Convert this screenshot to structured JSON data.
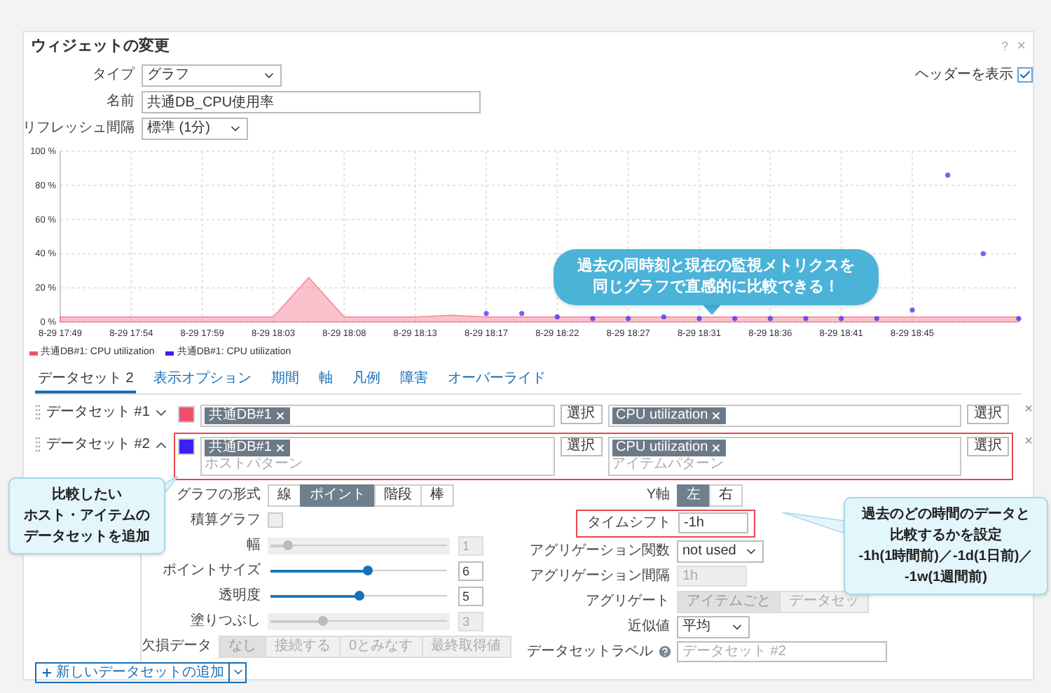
{
  "dialog": {
    "title": "ウィジェットの変更",
    "help": "?",
    "close": "×"
  },
  "form": {
    "type": {
      "label": "タイプ",
      "value": "グラフ"
    },
    "name": {
      "label": "名前",
      "value": "共通DB_CPU使用率"
    },
    "refresh": {
      "label": "リフレッシュ間隔",
      "value": "標準 (1分)"
    },
    "show_header": {
      "label": "ヘッダーを表示",
      "checked": true
    }
  },
  "chart_data": {
    "type": "line",
    "grid": true,
    "ylim": [
      0,
      100
    ],
    "yticks": [
      {
        "value": 0,
        "label": "0 %"
      },
      {
        "value": 20,
        "label": "20 %"
      },
      {
        "value": 40,
        "label": "40 %"
      },
      {
        "value": 60,
        "label": "60 %"
      },
      {
        "value": 80,
        "label": "80 %"
      },
      {
        "value": 100,
        "label": "100 %"
      }
    ],
    "categories": [
      "8-29 17:49",
      null,
      "8-29 17:54",
      null,
      "8-29 17:59",
      null,
      "8-29 18:03",
      null,
      "8-29 18:08",
      null,
      "8-29 18:13",
      null,
      "8-29 18:17",
      null,
      "8-29 18:22",
      null,
      "8-29 18:27",
      null,
      "8-29 18:31",
      null,
      "8-29 18:36",
      null,
      "8-29 18:41",
      null,
      "8-29 18:45",
      null,
      null,
      null
    ],
    "series": [
      {
        "name": "共通DB#1: CPU utilization",
        "color": "#f0506e",
        "type": "area",
        "values": [
          3,
          3,
          3,
          3,
          3,
          3,
          3,
          26,
          3,
          3,
          3,
          4,
          3,
          3,
          3,
          3,
          3,
          3,
          3,
          3,
          3,
          3,
          3,
          3,
          3,
          3,
          3,
          3
        ]
      },
      {
        "name": "共通DB#1: CPU utilization",
        "color": "#3b1ff5",
        "type": "scatter",
        "values": [
          null,
          null,
          null,
          null,
          null,
          null,
          null,
          null,
          null,
          null,
          null,
          null,
          5,
          5,
          3,
          2,
          2,
          3,
          2,
          2,
          2,
          2,
          2,
          2,
          7,
          86,
          40,
          2
        ]
      }
    ]
  },
  "callouts": [
    {
      "kind": "main",
      "lines": [
        "過去の同時刻と現在の監視メトリクスを",
        "同じグラフで直感的に比較できる！"
      ]
    },
    {
      "kind": "note",
      "lines": [
        "比較したい",
        "ホスト・アイテムの",
        "データセットを追加"
      ]
    },
    {
      "kind": "note",
      "lines": [
        "過去のどの時間のデータと",
        "比較するかを設定",
        "-1h(1時間前)／-1d(1日前)／",
        "-1w(1週間前)"
      ]
    }
  ],
  "tabs": [
    {
      "label": "データセット 2",
      "selected": true
    },
    {
      "label": "表示オプション",
      "selected": false
    },
    {
      "label": "期間",
      "selected": false
    },
    {
      "label": "軸",
      "selected": false
    },
    {
      "label": "凡例",
      "selected": false
    },
    {
      "label": "障害",
      "selected": false
    },
    {
      "label": "オーバーライド",
      "selected": false
    }
  ],
  "datasets": [
    {
      "label": "データセット #1",
      "expanded": false,
      "highlighted": false,
      "color": "#f0506e",
      "host_tags": [
        "共通DB#1"
      ],
      "item_tags": [
        "CPU utilization"
      ],
      "select_host": "選択",
      "select_item": "選択",
      "remove": "×"
    },
    {
      "label": "データセット #2",
      "expanded": true,
      "highlighted": true,
      "color": "#3b1ff5",
      "host_tags": [
        "共通DB#1"
      ],
      "host_placeholder": "ホストパターン",
      "item_tags": [
        "CPU utilization"
      ],
      "item_placeholder": "アイテムパターン",
      "select_host": "選択",
      "select_item": "選択",
      "remove": "×"
    }
  ],
  "options_left": {
    "graph_type": {
      "label": "グラフの形式",
      "options": [
        {
          "label": "線",
          "selected": false
        },
        {
          "label": "ポイント",
          "selected": true
        },
        {
          "label": "階段",
          "selected": false
        },
        {
          "label": "棒",
          "selected": false
        }
      ]
    },
    "stacked": {
      "label": "積算グラフ",
      "checked": false,
      "disabled": true
    },
    "sliders": [
      {
        "label": "幅",
        "level": 0.1,
        "value": "1",
        "disabled": true
      },
      {
        "label": "ポイントサイズ",
        "level": 0.55,
        "value": "6",
        "disabled": false
      },
      {
        "label": "透明度",
        "level": 0.5,
        "value": "5",
        "disabled": false
      },
      {
        "label": "塗りつぶし",
        "level": 0.3,
        "value": "3",
        "disabled": true
      }
    ],
    "missing_data": {
      "label": "欠損データ",
      "disabled": true,
      "options": [
        {
          "label": "なし",
          "selected": true
        },
        {
          "label": "接続する",
          "selected": false
        },
        {
          "label": "0とみなす",
          "selected": false
        },
        {
          "label": "最終取得値",
          "selected": false
        }
      ]
    }
  },
  "options_right": {
    "y_axis": {
      "label": "Y軸",
      "options": [
        {
          "label": "左",
          "selected": true
        },
        {
          "label": "右",
          "selected": false
        }
      ]
    },
    "time_shift": {
      "label": "タイムシフト",
      "value": "-1h",
      "highlighted": true
    },
    "aggregation_function": {
      "label": "アグリゲーション関数",
      "value": "not used"
    },
    "aggregation_interval": {
      "label": "アグリゲーション間隔",
      "value": "1h",
      "disabled": true
    },
    "aggregate": {
      "label": "アグリゲート",
      "disabled": true,
      "options": [
        {
          "label": "アイテムごと",
          "selected": true
        },
        {
          "label": "データセッ",
          "selected": false
        }
      ]
    },
    "approximation": {
      "label": "近似値",
      "value": "平均"
    },
    "dataset_label": {
      "label": "データセットラベル",
      "placeholder": "データセット #2"
    }
  },
  "add_dataset": {
    "label": "新しいデータセットの追加"
  }
}
